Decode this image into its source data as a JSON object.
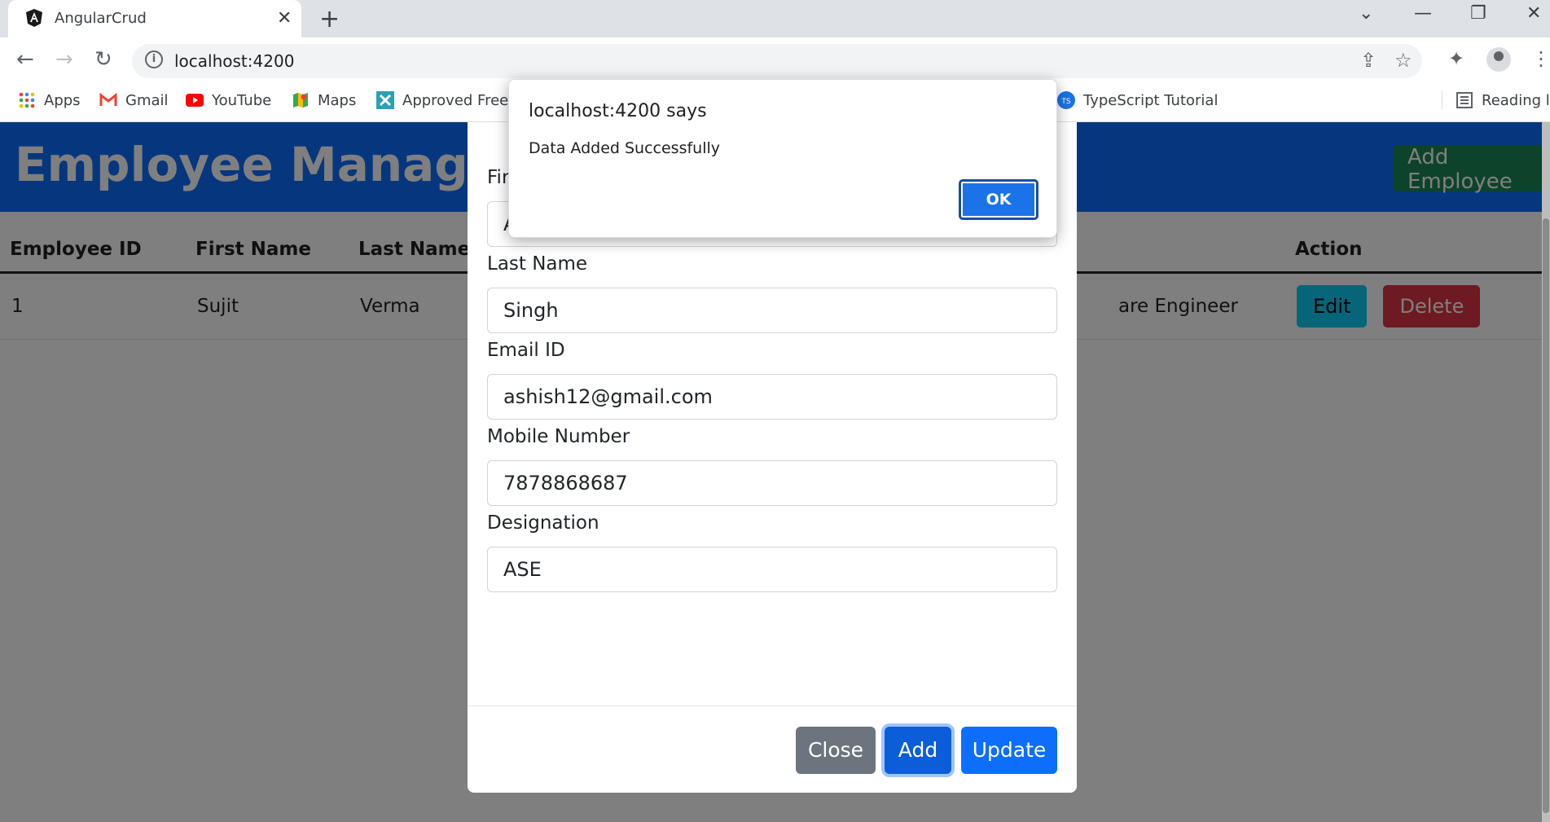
{
  "browser": {
    "tab_title": "AngularCrud",
    "tab_close": "✕",
    "new_tab": "+",
    "url": "localhost:4200",
    "bookmarks": [
      {
        "label": "Apps",
        "icon": "apps-grid-icon"
      },
      {
        "label": "Gmail",
        "icon": "gmail-icon"
      },
      {
        "label": "YouTube",
        "icon": "youtube-icon"
      },
      {
        "label": "Maps",
        "icon": "maps-icon"
      },
      {
        "label": "Approved Freew",
        "icon": "approved-freeware-icon"
      },
      {
        "label": "TypeScript Tutorial",
        "icon": "typescript-icon"
      },
      {
        "label": "Reading list",
        "icon": "reading-list-icon"
      }
    ]
  },
  "navbar": {
    "brand": "Employee Managem",
    "add_button": "Add Employee"
  },
  "table": {
    "headers": [
      "Employee ID",
      "First Name",
      "Last Name",
      "",
      "Action"
    ],
    "rows": [
      {
        "id": "1",
        "first": "Sujit",
        "last": "Verma",
        "designation": "are Engineer",
        "edit": "Edit",
        "delete": "Delete"
      }
    ]
  },
  "modal": {
    "fields": [
      {
        "label": "Fir",
        "value": "A"
      },
      {
        "label": "Last Name",
        "value": "Singh"
      },
      {
        "label": "Email ID",
        "value": "ashish12@gmail.com"
      },
      {
        "label": "Mobile Number",
        "value": "7878868687"
      },
      {
        "label": "Designation",
        "value": "ASE"
      }
    ],
    "close_label": "Close",
    "add_label": "Add",
    "update_label": "Update"
  },
  "alert": {
    "title": "localhost:4200 says",
    "message": "Data Added Successfully",
    "ok_label": "OK"
  },
  "colors": {
    "primary": "#0d6efd",
    "success": "#198754",
    "info": "#0dcaf0",
    "danger": "#dc3545",
    "secondary": "#6c757d",
    "chrome_blue": "#1a73e8"
  }
}
